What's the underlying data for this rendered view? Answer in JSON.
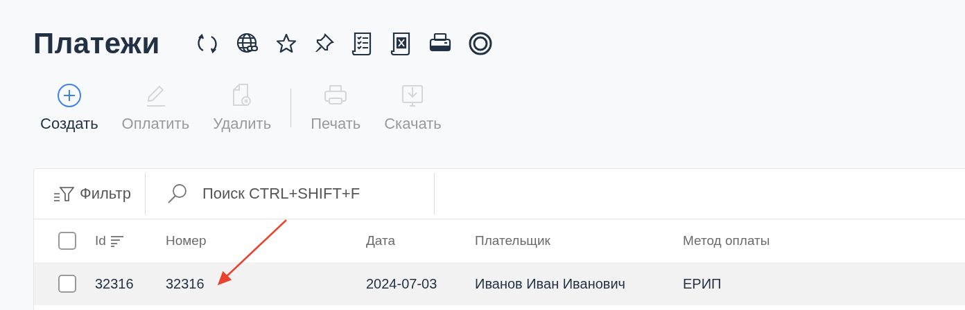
{
  "title": "Платежи",
  "toolbar": [
    {
      "label": "Создать",
      "kind": "create",
      "disabled": false
    },
    {
      "label": "Оплатить",
      "kind": "pay",
      "disabled": true
    },
    {
      "label": "Удалить",
      "kind": "delete",
      "disabled": true
    },
    {
      "label": "Печать",
      "kind": "print",
      "disabled": true
    },
    {
      "label": "Скачать",
      "kind": "download",
      "disabled": true
    }
  ],
  "filter": {
    "label": "Фильтр"
  },
  "search": {
    "placeholder": "Поиск CTRL+SHIFT+F"
  },
  "table": {
    "columns": [
      {
        "label": "Id",
        "sorted": true
      },
      {
        "label": "Номер",
        "sorted": false
      },
      {
        "label": "Дата",
        "sorted": false
      },
      {
        "label": "Плательщик",
        "sorted": false
      },
      {
        "label": "Метод оплаты",
        "sorted": false
      }
    ],
    "header_checked": false,
    "rows": [
      {
        "checked": false,
        "cells": [
          "32316",
          "32316",
          "2024-07-03",
          "Иванов Иван Иванович",
          "ЕРИП"
        ]
      }
    ]
  }
}
